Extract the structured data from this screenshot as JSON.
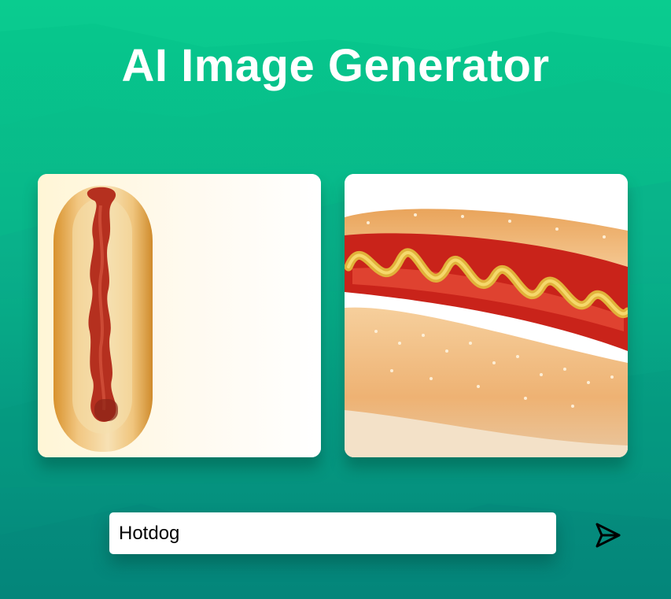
{
  "header": {
    "title": "AI Image Generator"
  },
  "gallery": {
    "images": [
      {
        "subject": "hotdog with ketchup"
      },
      {
        "subject": "hotdog with mustard"
      }
    ]
  },
  "prompt": {
    "value": "Hotdog",
    "send_icon": "paper-plane-icon"
  },
  "colors": {
    "background_top": "#07c98c",
    "background_bottom": "#04857a",
    "title": "#ffffff",
    "input_background": "#ffffff"
  }
}
